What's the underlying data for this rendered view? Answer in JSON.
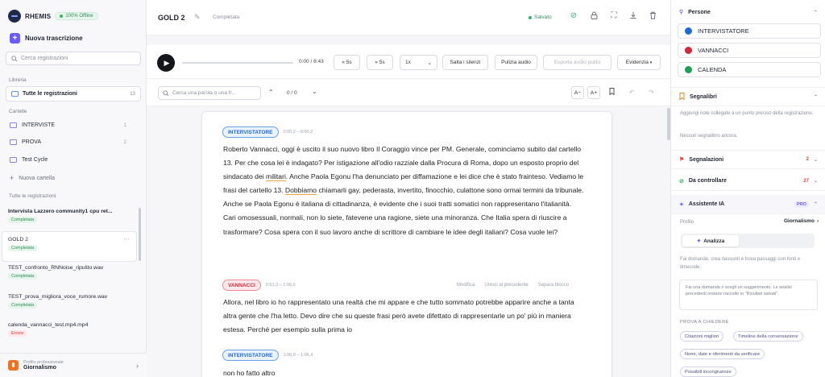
{
  "app": {
    "name": "RHEMIS",
    "offline_badge": "100% Offline"
  },
  "sidebar": {
    "new_button": "Nuova trascrizione",
    "search_placeholder": "Cerca registrazioni",
    "library_label": "Libreria",
    "all_recordings": {
      "label": "Tutte le registrazioni",
      "count": "13"
    },
    "folders_label": "Cartelle",
    "folders": [
      {
        "label": "INTERVISTE",
        "count": "1"
      },
      {
        "label": "PROVA",
        "count": "2"
      },
      {
        "label": "Test Cycle",
        "count": ""
      }
    ],
    "new_folder": "Nuova cartella",
    "recordings_label": "Tutte le registrazioni",
    "recordings": [
      {
        "title": "Intervista Lazzero community1 cpu ret...",
        "status": "Completata"
      },
      {
        "title": "GOLD 2",
        "status": "Completata"
      },
      {
        "title": "TEST_confronto_RNNoise_ripulito.wav",
        "status": "Completata"
      },
      {
        "title": "TEST_prova_migliora_voce_rumore.wav",
        "status": "Completata"
      },
      {
        "title": "calenda_vannacci_test.mp4.mp4",
        "status": "Errore"
      }
    ],
    "profile": {
      "label": "Profilo professionale",
      "value": "Giornalismo"
    }
  },
  "header": {
    "title": "GOLD 2",
    "status": "Completata",
    "saved": "Salvato"
  },
  "player": {
    "time": "0:00 / 8:43",
    "back": "5s",
    "forward": "5s",
    "speed": "1x",
    "skip_silence": "Salta i silenzi",
    "clean_audio": "Pulizia audio",
    "export_clean": "Esporta audio pulito",
    "highlight": "Evidenzia"
  },
  "find": {
    "placeholder": "Cerca una parola o una fr...",
    "counter": "0 / 0",
    "font_down": "A−",
    "font_up": "A+"
  },
  "transcript": [
    {
      "speaker": "INTERVISTATORE",
      "time": "0:00,2 – 0:50,2",
      "segments": [
        "Roberto Vannacci, oggi è uscito il suo nuovo libro Il Coraggio vince per PM. Generale, cominciamo subito dal cartello 13. Per che cosa lei è indagato? Per istigazione all'odio razziale dalla Procura di Roma, dopo un esposto proprio del sindacato dei ",
        "militari",
        ". Anche Paola Egonu l'ha denunciato per diffamazione e lei dice che è stato frainteso. Vediamo le frasi del cartello 13. ",
        "Dobbiamo",
        " chiamarli gay, pederasta, invertito, finocchio, culattone sono ormai termini da tribunale. Anche se Paola Egonu è italiana di cittadinanza, è evidente che i suoi tratti somatici non rappresentano l'italianità. Cari omosessuali, normali, non lo siete, fatevene una ragione, siete una minoranza. Che Italia spera di riuscire a trasformare? Cosa spera con il suo lavoro anche di scrittore di cambiare le idee degli italiani? Cosa vuole lei?"
      ]
    },
    {
      "speaker": "VANNACCI",
      "time": "0:51,3 – 1:06,0",
      "text": "Allora, nel libro io ho rappresentato una realtà che mi appare e che tutto sommato potrebbe apparire anche a tanta altra gente che l'ha letto. Devo dire che su queste frasi però avete difettato di rappresentarle un po' più in maniera estesa. Perché per esempio sulla prima io",
      "actions": [
        "Modifica",
        "Unisci al precedente",
        "Separa blocco"
      ]
    },
    {
      "speaker": "INTERVISTATORE",
      "time": "1:06,0 – 1:06,4",
      "text": "non ho fatto altro"
    }
  ],
  "panel": {
    "people_title": "Persone",
    "people": [
      {
        "name": "INTERVISTATORE",
        "color": "#1e6ad6"
      },
      {
        "name": "VANNACCI",
        "color": "#d22a3a"
      },
      {
        "name": "CALENDA",
        "color": "#1f9d55"
      }
    ],
    "bookmarks_title": "Segnalibri",
    "bookmarks_hint": "Aggiungi note collegate a un punto preciso della registrazione.",
    "bookmarks_empty": "Nessun segnalibro ancora.",
    "reports": {
      "label": "Segnalazioni",
      "count": "2"
    },
    "to_check": {
      "label": "Da controllare",
      "count": "27"
    },
    "assistant": {
      "label": "Assistente IA",
      "badge": "PRO"
    },
    "profile_label": "Profilo",
    "profile_value": "Giornalismo",
    "tab_analyze": "Analizza",
    "assistant_hint": "Fai domande, crea riassunti e trova passaggi con fonti e timecode.",
    "assistant_box": "Fai una domanda o scegli un suggerimento. Le analisi precedenti restano raccolte in \"Risultati salvati\".",
    "suggestions_title": "PROVA A CHIEDERE",
    "suggestions": [
      "Citazioni migliori",
      "Timeline della conversazione",
      "Nomi, date e riferimenti da verificare",
      "Possibili incongruenze"
    ]
  }
}
